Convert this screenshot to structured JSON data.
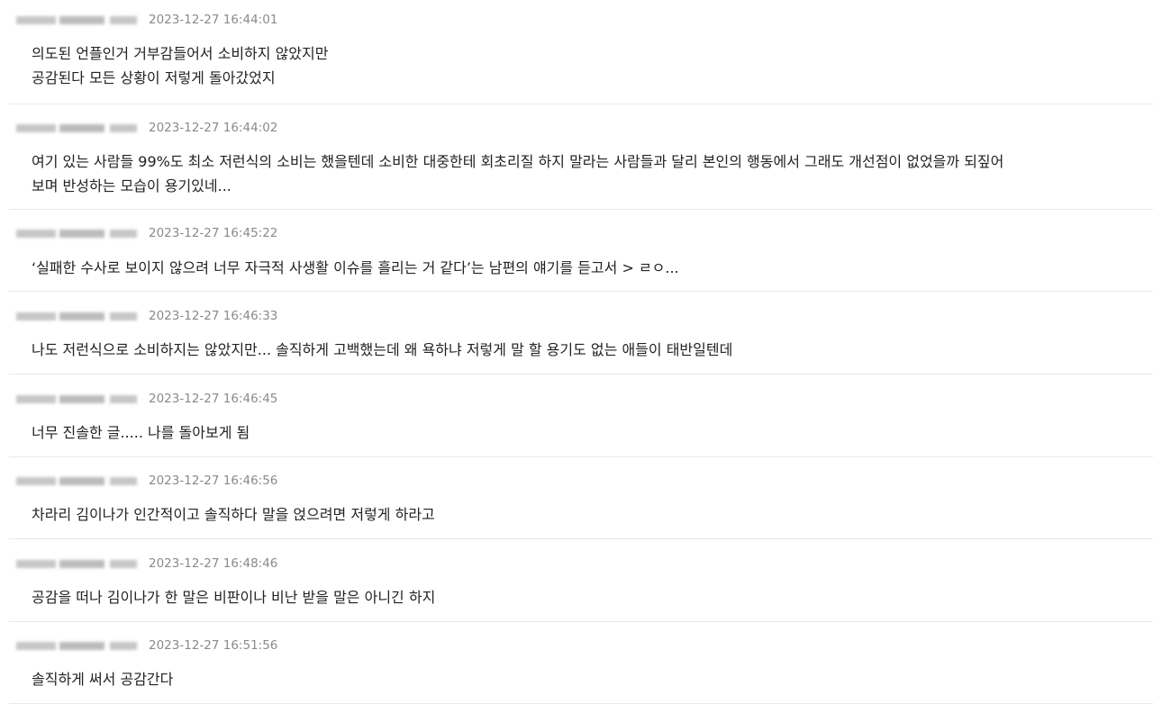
{
  "comments": [
    {
      "date": "2023-12-27 16:44:01",
      "text": "의도된 언플인거 거부감들어서 소비하지 않았지만\n공감된다 모든 상황이 저렇게 돌아갔었지"
    },
    {
      "date": "2023-12-27 16:44:02",
      "text": "여기 있는 사람들 99%도 최소 저런식의 소비는 했을텐데 소비한 대중한테 회초리질 하지 말라는 사람들과 달리 본인의 행동에서 그래도 개선점이 없었을까 되짚어\n보며 반성하는 모습이 용기있네..."
    },
    {
      "date": "2023-12-27 16:45:22",
      "text": "‘실패한 수사로 보이지 않으려 너무 자극적 사생활 이슈를 흘리는 거 같다’는 남편의 얘기를 듣고서 > ㄹㅇ..."
    },
    {
      "date": "2023-12-27 16:46:33",
      "text": "나도 저런식으로 소비하지는 않았지만... 솔직하게 고백했는데 왜 욕하냐 저렇게 말 할 용기도 없는 애들이 태반일텐데"
    },
    {
      "date": "2023-12-27 16:46:45",
      "text": "너무 진솔한 글..... 나를 돌아보게 됨"
    },
    {
      "date": "2023-12-27 16:46:56",
      "text": "차라리 김이나가 인간적이고 솔직하다 말을 얹으려면 저렇게 하라고"
    },
    {
      "date": "2023-12-27 16:48:46",
      "text": "공감을 떠나 김이나가 한 말은 비판이나 비난 받을 말은 아니긴 하지"
    },
    {
      "date": "2023-12-27 16:51:56",
      "text": "솔직하게 써서 공감간다"
    }
  ]
}
